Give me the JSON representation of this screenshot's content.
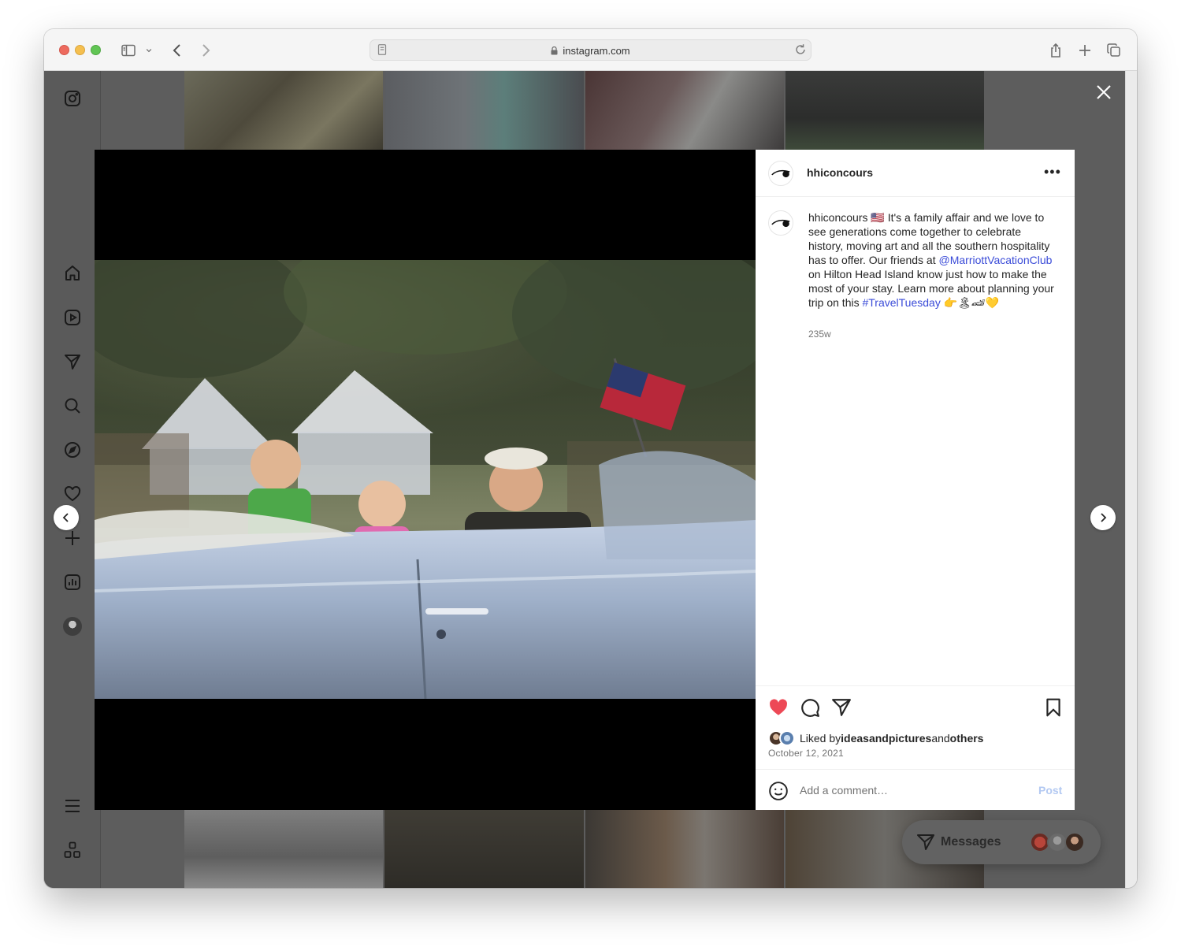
{
  "browser": {
    "url": "instagram.com"
  },
  "post": {
    "username": "hhiconcours",
    "caption_user": "hhiconcours",
    "caption_emoji_1": "🇺🇸",
    "caption_part1": " It's a family affair and we love to see generations come together to celebrate history, moving art and all the southern hospitality has to offer. Our friends at ",
    "mention": "@MarriottVacationClub",
    "caption_part2": " on Hilton Head Island know just how to make the most of your stay. Learn more about planning your trip on this ",
    "hashtag": "#TravelTuesday",
    "caption_emojis_end": " 👉🏝🏎💛",
    "time_ago": "235w",
    "liked_by_prefix": "Liked by ",
    "liked_by_user": "ideasandpictures",
    "liked_by_and": " and ",
    "liked_by_others": "others",
    "date": "October 12, 2021"
  },
  "comment": {
    "placeholder": "Add a comment…",
    "post_label": "Post"
  },
  "messages": {
    "label": "Messages"
  },
  "colors": {
    "like_red": "#ed4956",
    "link_blue": "#3a4bd8",
    "post_disabled": "#b3c9f2"
  }
}
